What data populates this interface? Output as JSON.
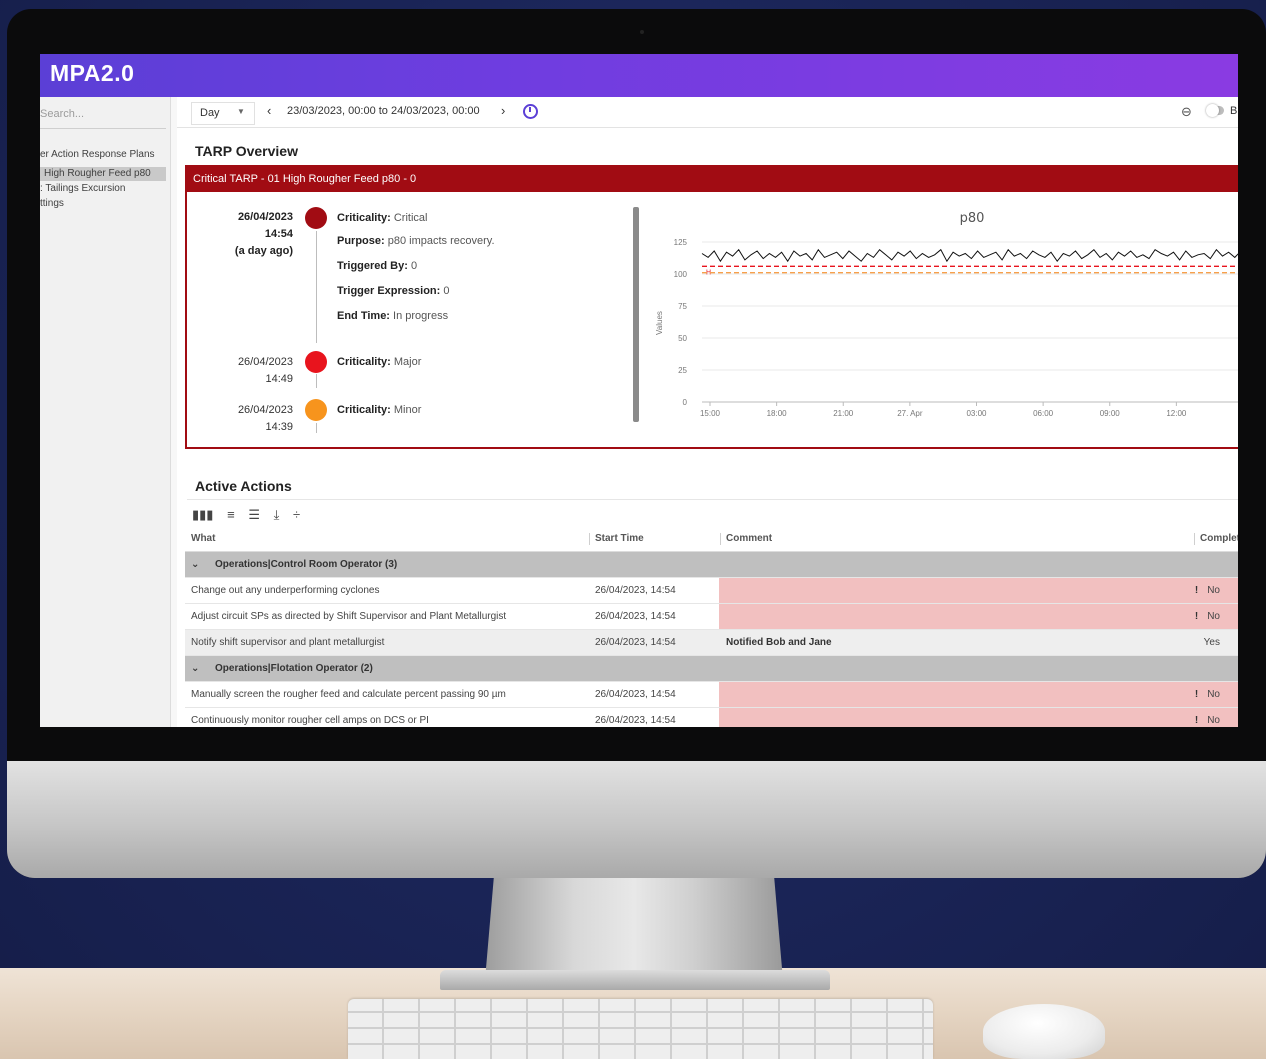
{
  "app": {
    "title": "MPA2.0"
  },
  "sidebar": {
    "search_placeholder": "Search...",
    "items": [
      {
        "label": "er Action Response Plans"
      },
      {
        "label": "High Rougher Feed p80"
      },
      {
        "label": ": Tailings Excursion"
      },
      {
        "label": "ttings"
      }
    ]
  },
  "toolbar": {
    "range": "Day",
    "date_range": "23/03/2023, 00:00 to 24/03/2023, 00:00",
    "trailing_text": "B"
  },
  "tarp_overview": {
    "title": "TARP Overview",
    "header": "Critical TARP - 01 High Rougher Feed p80 - 0",
    "timeline": [
      {
        "date": "26/04/2023",
        "time": "14:54",
        "relative": "(a day ago)",
        "color": "#a10c13",
        "criticality_label": "Criticality:",
        "criticality": "Critical",
        "purpose_label": "Purpose:",
        "purpose": "p80 impacts recovery.",
        "triggered_label": "Triggered By:",
        "triggered": "0",
        "expression_label": "Trigger Expression:",
        "expression": "0",
        "end_label": "End Time:",
        "end": "In progress"
      },
      {
        "date": "26/04/2023",
        "time": "14:49",
        "color": "#e8141d",
        "criticality_label": "Criticality:",
        "criticality": "Major"
      },
      {
        "date": "26/04/2023",
        "time": "14:39",
        "color": "#f7941d",
        "criticality_label": "Criticality:",
        "criticality": "Minor"
      }
    ]
  },
  "chart_data": {
    "type": "line",
    "title": "p80",
    "ylabel": "Values",
    "xlabel": "",
    "ylim": [
      0,
      125
    ],
    "yticks": [
      0,
      25,
      50,
      75,
      100,
      125
    ],
    "xticks": [
      "15:00",
      "18:00",
      "21:00",
      "27. Apr",
      "03:00",
      "06:00",
      "09:00",
      "12:00"
    ],
    "series": [
      {
        "color": "#111111",
        "values": [
          116,
          113,
          118,
          110,
          117,
          114,
          119,
          111,
          115,
          118,
          112,
          116,
          113,
          117,
          110,
          118,
          114,
          116,
          111,
          119,
          113,
          115,
          117,
          112,
          118,
          114,
          110,
          116,
          113,
          119,
          115,
          111,
          117,
          114,
          118,
          112,
          116,
          113,
          115,
          119,
          110,
          117,
          114,
          116,
          112,
          118,
          113,
          115,
          117,
          111,
          119,
          114,
          116,
          112,
          118,
          115,
          113,
          117,
          110,
          116,
          114,
          118,
          112,
          115,
          119,
          113,
          116,
          111,
          117,
          114,
          118,
          113,
          115,
          112,
          119,
          116,
          114,
          117,
          111,
          118,
          113,
          115,
          116,
          112,
          119,
          114,
          117,
          113,
          118,
          115
        ]
      }
    ],
    "thresholds": [
      {
        "value": 106,
        "color": "#e8141d",
        "label": "H"
      },
      {
        "value": 101,
        "color": "#f7a04b"
      }
    ],
    "grid": true,
    "legend": "none"
  },
  "active_actions": {
    "title": "Active Actions",
    "toolbar_icons": [
      "columns-icon",
      "filter-icon",
      "density-icon",
      "export-icon",
      "expand-icon"
    ],
    "columns": [
      "What",
      "Start Time",
      "Comment",
      "Complet"
    ],
    "groups": [
      {
        "label": "Operations|Control Room Operator (3)",
        "rows": [
          {
            "what": "Change out any underperforming cyclones",
            "start": "26/04/2023, 14:54",
            "comment": "",
            "done": "No",
            "flag": true
          },
          {
            "what": "Adjust circuit SPs as directed by Shift Supervisor and Plant Metallurgist",
            "start": "26/04/2023, 14:54",
            "comment": "",
            "done": "No",
            "flag": true
          },
          {
            "what": "Notify shift supervisor and plant metallurgist",
            "start": "26/04/2023, 14:54",
            "comment": "Notified Bob and Jane",
            "done": "Yes",
            "flag": false
          }
        ]
      },
      {
        "label": "Operations|Flotation Operator (2)",
        "rows": [
          {
            "what": "Manually screen the rougher feed and calculate percent passing 90 µm",
            "start": "26/04/2023, 14:54",
            "comment": "",
            "done": "No",
            "flag": true
          },
          {
            "what": "Continuously monitor rougher cell amps on DCS or PI",
            "start": "26/04/2023, 14:54",
            "comment": "",
            "done": "No",
            "flag": true
          }
        ]
      }
    ]
  }
}
